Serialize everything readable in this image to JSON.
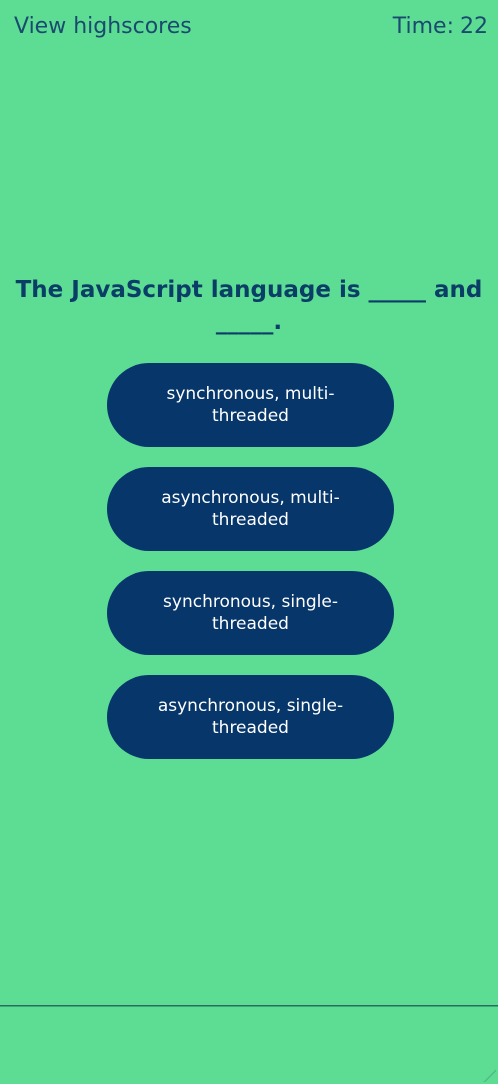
{
  "header": {
    "highscores_label": "View highscores",
    "timer_label": "Time:",
    "timer_value": "22"
  },
  "quiz": {
    "question": "The JavaScript language is _____ and _____.",
    "answers": [
      "synchronous, multi-threaded",
      "asynchronous, multi-threaded",
      "synchronous, single-threaded",
      "asynchronous, single-threaded"
    ]
  },
  "colors": {
    "background": "#5ddc94",
    "button": "#06366a",
    "text": "#0b3e66",
    "button_text": "#ffffff"
  }
}
